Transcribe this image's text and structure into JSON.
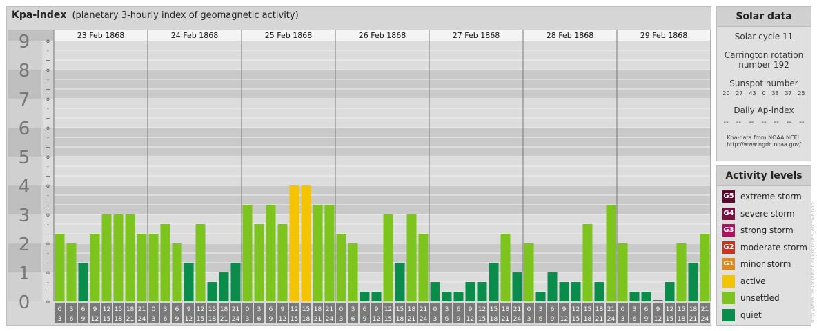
{
  "header": {
    "title": "Kpa-index",
    "subtitle": "(planetary 3-hourly index of geomagnetic activity)"
  },
  "chart_data": {
    "type": "bar",
    "title": "Kpa-index",
    "subtitle": "(planetary 3-hourly index of geomagnetic activity)",
    "ylim": [
      0,
      9
    ],
    "y_ticks": [
      "0",
      "1",
      "2",
      "3",
      "4",
      "5",
      "6",
      "7",
      "8",
      "9"
    ],
    "sub_ticks": [
      "o",
      "+",
      "-"
    ],
    "days": [
      "23 Feb 1868",
      "24 Feb 1868",
      "25 Feb 1868",
      "26 Feb 1868",
      "27 Feb 1868",
      "28 Feb 1868",
      "29 Feb 1868"
    ],
    "interval_labels": [
      [
        "0",
        "3"
      ],
      [
        "3",
        "6"
      ],
      [
        "6",
        "9"
      ],
      [
        "9",
        "12"
      ],
      [
        "12",
        "15"
      ],
      [
        "15",
        "18"
      ],
      [
        "18",
        "21"
      ],
      [
        "21",
        "24"
      ]
    ],
    "values": [
      2.333,
      2.0,
      1.333,
      2.333,
      3.0,
      3.0,
      3.0,
      2.333,
      2.333,
      2.667,
      2.0,
      1.333,
      2.667,
      0.667,
      1.0,
      1.333,
      3.333,
      2.667,
      3.333,
      2.667,
      4.0,
      4.0,
      3.333,
      3.333,
      2.333,
      2.0,
      0.333,
      0.333,
      3.0,
      1.333,
      3.0,
      2.333,
      0.667,
      0.333,
      0.333,
      0.667,
      0.667,
      1.333,
      2.333,
      1.0,
      2.0,
      0.333,
      1.0,
      0.667,
      0.667,
      2.667,
      0.667,
      3.333,
      2.0,
      0.333,
      0.333,
      0.0,
      0.667,
      2.0,
      1.333,
      2.333
    ],
    "colors": {
      "quiet": "#0a8c4a",
      "unsettled": "#7ec41e",
      "active": "#f5c400"
    }
  },
  "solar": {
    "title": "Solar data",
    "cycle": "Solar cycle 11",
    "carrington_1": "Carrington rotation",
    "carrington_2": "number 192",
    "sunspot_title": "Sunspot number",
    "sunspots": [
      "20",
      "27",
      "43",
      "0",
      "38",
      "37",
      "25"
    ],
    "ap_title": "Daily Ap-index",
    "ap": [
      "--",
      "--",
      "--",
      "--",
      "--",
      "--",
      "--"
    ],
    "source_1": "Kpa-data from NOAA NCEI:",
    "source_2": "http://www.ngdc.noaa.gov/"
  },
  "activity": {
    "title": "Activity levels",
    "levels": [
      {
        "badge": "G5",
        "label": "extreme storm",
        "color": "#5a0a2c"
      },
      {
        "badge": "G4",
        "label": "severe storm",
        "color": "#7a1040"
      },
      {
        "badge": "G3",
        "label": "strong storm",
        "color": "#a8125a"
      },
      {
        "badge": "G2",
        "label": "moderate storm",
        "color": "#c8321e"
      },
      {
        "badge": "G1",
        "label": "minor storm",
        "color": "#e08a1a"
      },
      {
        "badge": "",
        "label": "active",
        "color": "#f5c400"
      },
      {
        "badge": "",
        "label": "unsettled",
        "color": "#7ec41e"
      },
      {
        "badge": "",
        "label": "quiet",
        "color": "#0a8c4a"
      }
    ]
  },
  "watermark": "http://www.tieusorvision.ru/kpgraphs_archive.php"
}
